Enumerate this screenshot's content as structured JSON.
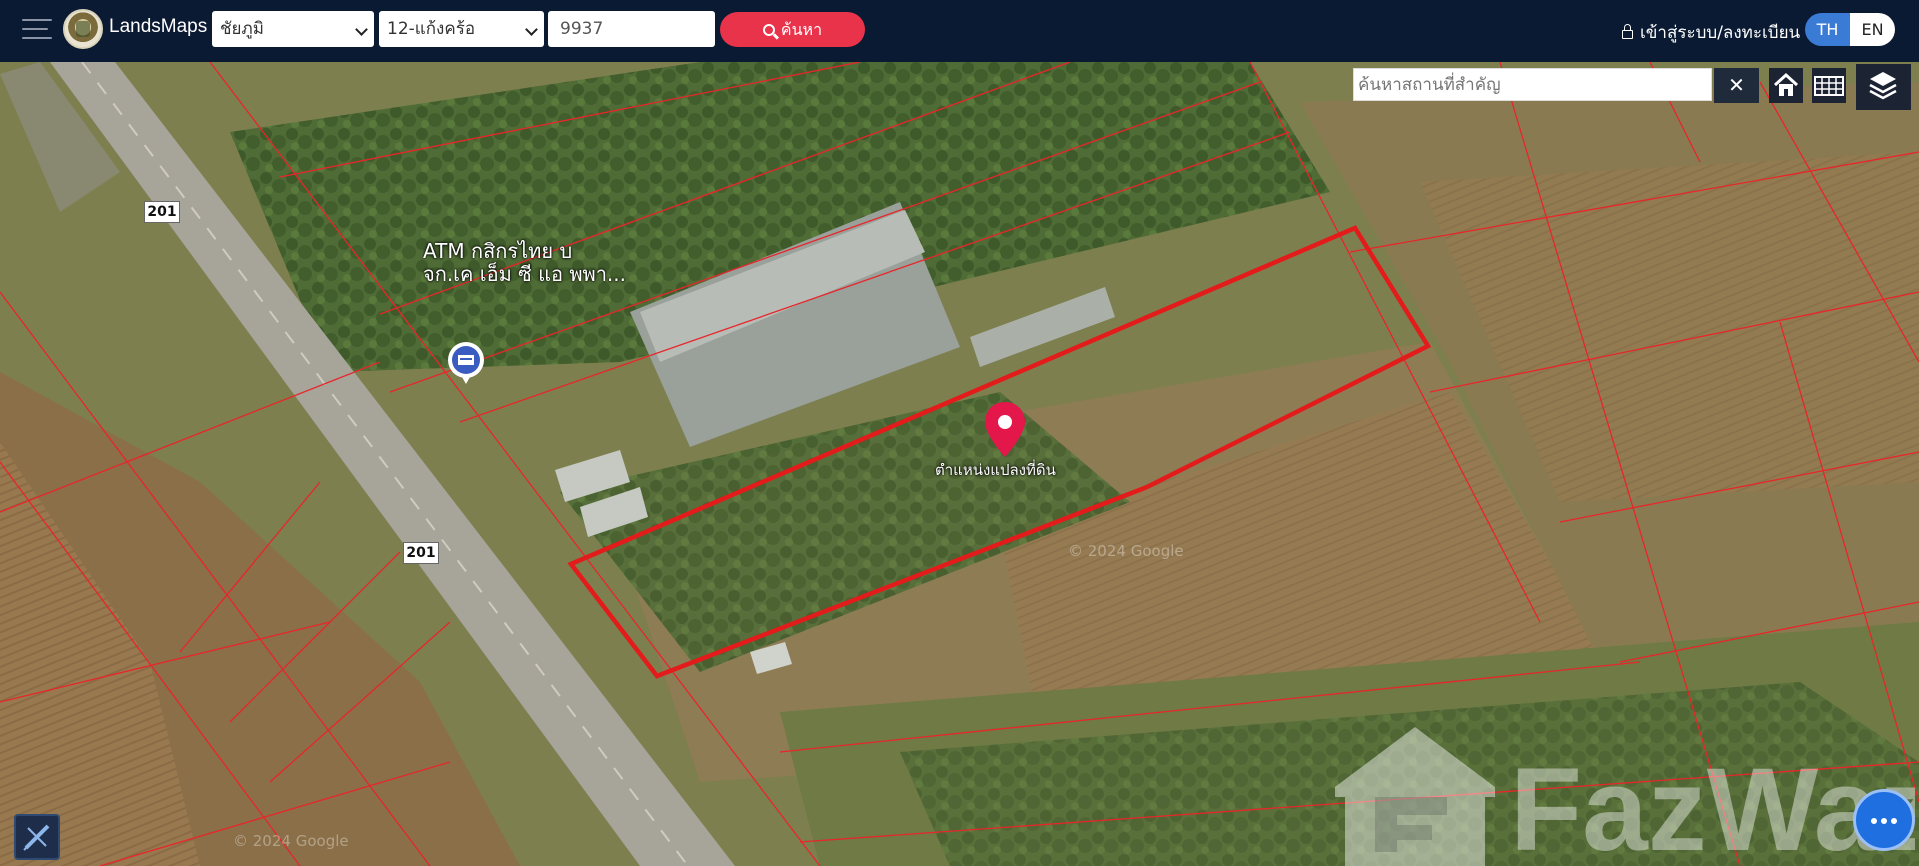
{
  "app": {
    "title": "LandsMaps"
  },
  "header": {
    "province": "ชัยภูมิ",
    "district": "12-แก้งคร้อ",
    "parcel_number": "9937",
    "search_label": "ค้นหา",
    "login_label": "เข้าสู่ระบบ/ลงทะเบียน",
    "lang_th": "TH",
    "lang_en": "EN"
  },
  "map": {
    "place_search_placeholder": "ค้นหาสถานที่สำคัญ",
    "clear_label": "✕",
    "pin_label": "ตำแหน่งแปลงที่ดิน",
    "atm_label_line1": "ATM กสิกรไทย บ",
    "atm_label_line2": "จก.เค เอ็ม ซี แอ พพา...",
    "road_number": "201",
    "google_copy": "© 2024 Google",
    "watermark": "FazWaz",
    "parcel_outline_color": "#e31b1b",
    "lot_line_color": "#e8262a",
    "icons": [
      "home-icon",
      "grid-icon",
      "layers-icon",
      "map-pin-icon",
      "atm-icon",
      "ruler-icon",
      "more-icon"
    ]
  }
}
